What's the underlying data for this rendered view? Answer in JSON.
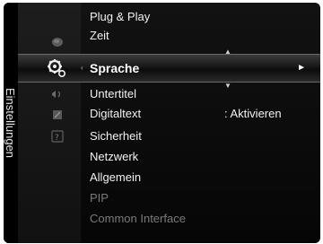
{
  "panel": {
    "side_title": "Einstellungen"
  },
  "menu": {
    "items_above": [
      {
        "label": "Plug & Play"
      },
      {
        "label": "Zeit"
      }
    ],
    "selected": {
      "label": "Sprache",
      "right_arrow": "►",
      "left_marker": "‹"
    },
    "items_below": [
      {
        "label": "Untertitel",
        "value": ""
      },
      {
        "label": "Digitaltext",
        "value": ": Aktivieren"
      },
      {
        "label": "Sicherheit",
        "value": ""
      },
      {
        "label": "Netzwerk",
        "value": ""
      },
      {
        "label": "Allgemein",
        "value": ""
      },
      {
        "label": "PIP",
        "value": "",
        "disabled": true
      },
      {
        "label": "Common Interface",
        "value": "",
        "disabled": true
      }
    ],
    "hints": {
      "up": "▲",
      "down": "▼"
    }
  },
  "icons": {
    "selected_category": "gears-settings-icon",
    "categories": [
      "picture-category-icon",
      "sound-category-icon",
      "input-category-icon",
      "application-category-icon",
      "support-category-icon"
    ]
  }
}
